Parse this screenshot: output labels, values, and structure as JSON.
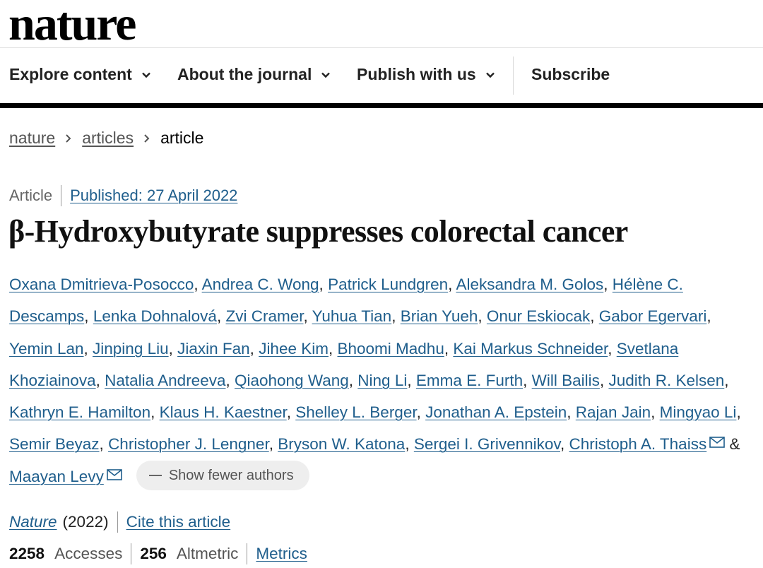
{
  "header": {
    "logo": "nature"
  },
  "nav": {
    "items": [
      {
        "label": "Explore content"
      },
      {
        "label": "About the journal"
      },
      {
        "label": "Publish with us"
      }
    ],
    "subscribe": "Subscribe"
  },
  "breadcrumb": {
    "items": [
      "nature",
      "articles"
    ],
    "current": "article"
  },
  "article": {
    "type": "Article",
    "published": "Published: 27 April 2022",
    "title": "β-Hydroxybutyrate suppresses colorectal cancer",
    "authors": [
      "Oxana Dmitrieva-Posocco",
      "Andrea C. Wong",
      "Patrick Lundgren",
      "Aleksandra M. Golos",
      "Hélène C. Descamps",
      "Lenka Dohnalová",
      "Zvi Cramer",
      "Yuhua Tian",
      "Brian Yueh",
      "Onur Eskiocak",
      "Gabor Egervari",
      "Yemin Lan",
      "Jinping Liu",
      "Jiaxin Fan",
      "Jihee Kim",
      "Bhoomi Madhu",
      "Kai Markus Schneider",
      "Svetlana Khoziainova",
      "Natalia Andreeva",
      "Qiaohong Wang",
      "Ning Li",
      "Emma E. Furth",
      "Will Bailis",
      "Judith R. Kelsen",
      "Kathryn E. Hamilton",
      "Klaus H. Kaestner",
      "Shelley L. Berger",
      "Jonathan A. Epstein",
      "Rajan Jain",
      "Mingyao Li",
      "Semir Beyaz",
      "Christopher J. Lengner",
      "Bryson W. Katona",
      "Sergei I. Grivennikov",
      "Christoph A. Thaiss",
      "Maayan Levy"
    ],
    "and_symbol": "&",
    "show_fewer_label": "Show fewer authors",
    "journal": "Nature",
    "year": "(2022)",
    "cite_label": "Cite this article",
    "accesses_count": "2258",
    "accesses_label": "Accesses",
    "altmetric_count": "256",
    "altmetric_label": "Altmetric",
    "metrics_label": "Metrics"
  }
}
